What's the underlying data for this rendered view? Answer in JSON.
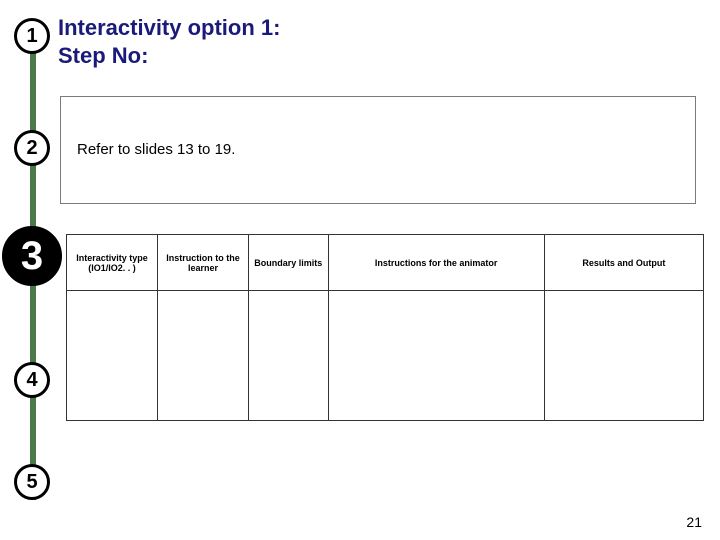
{
  "title": {
    "line1": "Interactivity option 1:",
    "line2": "Step No:"
  },
  "steps": {
    "s1": "1",
    "s2": "2",
    "s3": "3",
    "s4": "4",
    "s5": "5"
  },
  "refer_text": "Refer to slides 13 to 19.",
  "table": {
    "headers": {
      "h1": "Interactivity type (IO1/IO2. . )",
      "h2": "Instruction to the learner",
      "h3": "Boundary limits",
      "h4": "Instructions for the animator",
      "h5": "Results and Output"
    }
  },
  "slide_number": "21"
}
